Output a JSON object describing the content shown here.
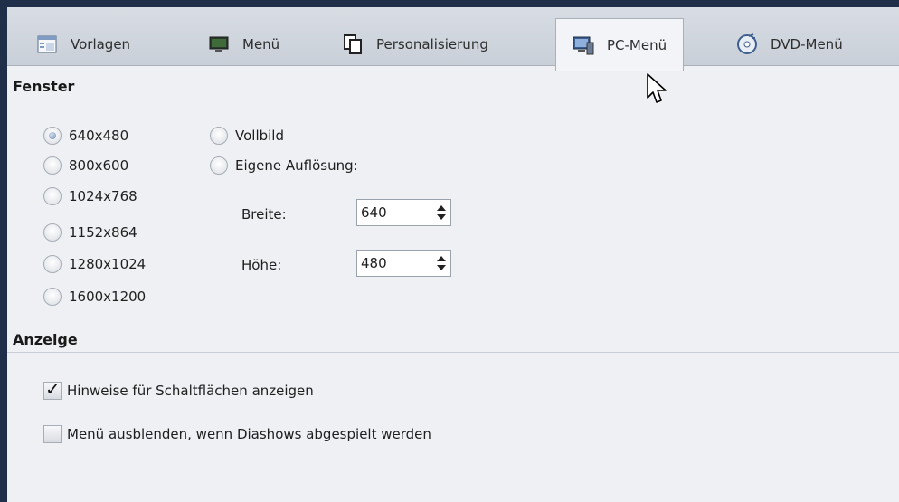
{
  "tabs": [
    {
      "label": "Vorlagen",
      "icon": "templates-icon"
    },
    {
      "label": "Menü",
      "icon": "monitor-icon"
    },
    {
      "label": "Personalisierung",
      "icon": "document-copy-icon"
    },
    {
      "label": "PC-Menü",
      "icon": "pc-menu-icon",
      "active": true
    },
    {
      "label": "DVD-Menü",
      "icon": "dvd-disc-icon"
    }
  ],
  "fenster": {
    "title": "Fenster",
    "resolutions": [
      "640x480",
      "800x600",
      "1024x768",
      "1152x864",
      "1280x1024",
      "1600x1200"
    ],
    "selected": "640x480",
    "fullscreen_label": "Vollbild",
    "custom_label": "Eigene Auflösung:",
    "width_label": "Breite:",
    "width_value": "640",
    "height_label": "Höhe:",
    "height_value": "480"
  },
  "anzeige": {
    "title": "Anzeige",
    "option1_label": "Hinweise für Schaltflächen anzeigen",
    "option1_checked": true,
    "option2_label": "Menü ausblenden, wenn Diashows abgespielt werden",
    "option2_checked": false
  },
  "colors": {
    "accent": "#1f2f4a",
    "panel": "#eef0f3"
  }
}
